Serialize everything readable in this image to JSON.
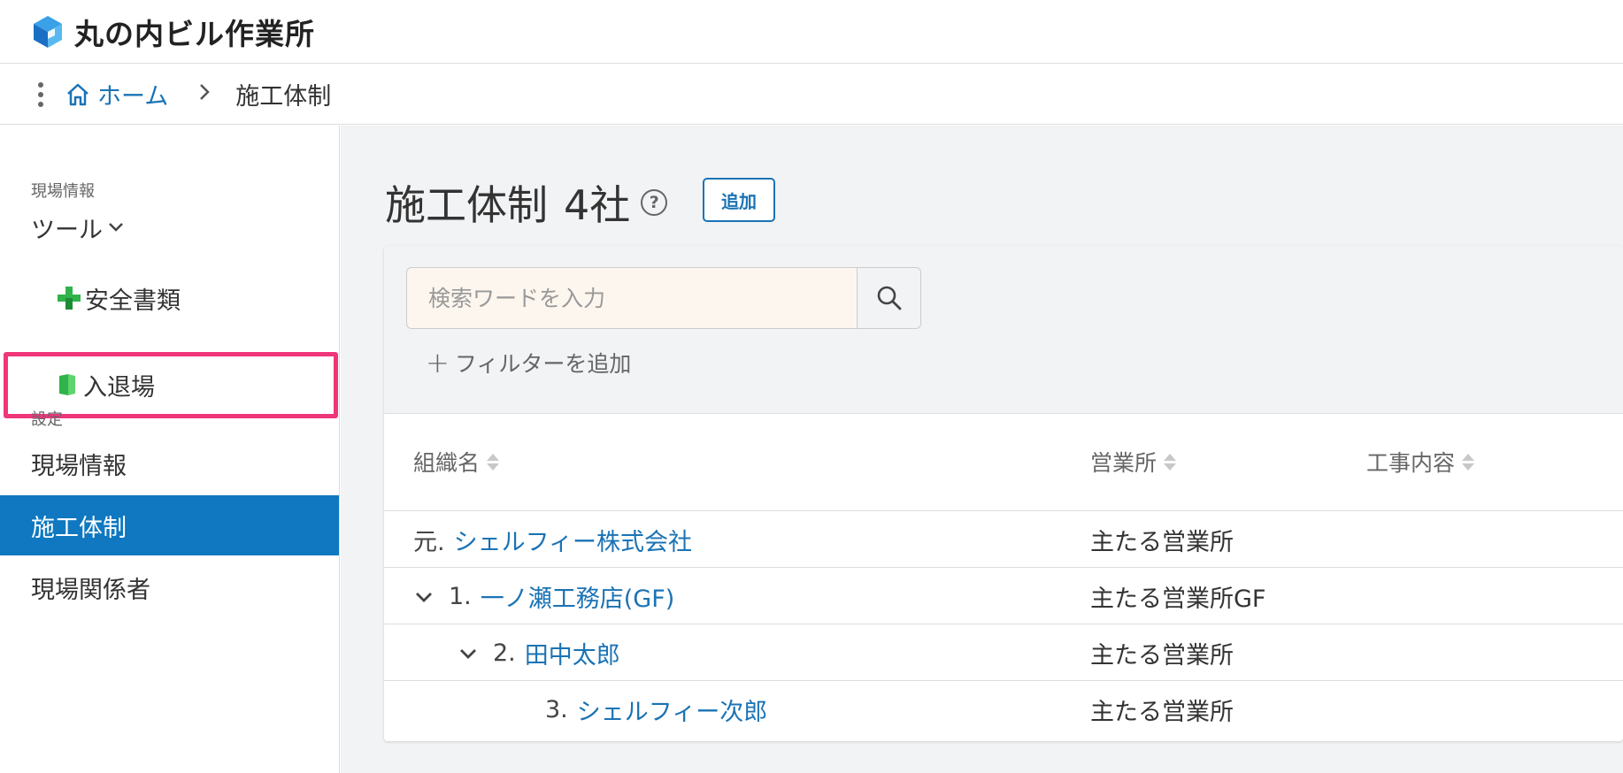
{
  "header": {
    "site_title": "丸の内ビル作業所",
    "logo_icon": "cube-logo-icon"
  },
  "breadcrumb": {
    "home_label": "ホーム",
    "current": "施工体制"
  },
  "sidebar": {
    "section_site_info": "現場情報",
    "tools_label": "ツール",
    "tool_items": [
      {
        "label": "安全書類",
        "icon": "green-cross-icon"
      },
      {
        "label": "入退場",
        "icon": "green-door-icon"
      }
    ],
    "section_settings": "設定",
    "settings_items": [
      {
        "label": "現場情報"
      },
      {
        "label": "施工体制"
      },
      {
        "label": "現場関係者"
      }
    ],
    "active_item": "施工体制"
  },
  "main": {
    "title": "施工体制",
    "count_label": "4社",
    "help_symbol": "?",
    "add_button": "追加",
    "search": {
      "placeholder": "検索ワードを入力",
      "value": ""
    },
    "add_filter_label": "フィルターを追加",
    "table": {
      "columns": [
        "組織名",
        "営業所",
        "工事内容"
      ],
      "rows": [
        {
          "rank": "元.",
          "name": "シェルフィー株式会社",
          "office": "主たる営業所",
          "expandable": false
        },
        {
          "rank": "1.",
          "name": "一ノ瀬工務店(GF)",
          "office": "主たる営業所GF",
          "expandable": true
        },
        {
          "rank": "2.",
          "name": "田中太郎",
          "office": "主たる営業所",
          "expandable": true
        },
        {
          "rank": "3.",
          "name": "シェルフィー次郎",
          "office": "主たる営業所",
          "expandable": false
        }
      ]
    }
  },
  "colors": {
    "accent": "#1a73b5",
    "active_bg": "#0f78c0",
    "highlight": "#f0367a",
    "tool_green": "#2fb34a"
  }
}
